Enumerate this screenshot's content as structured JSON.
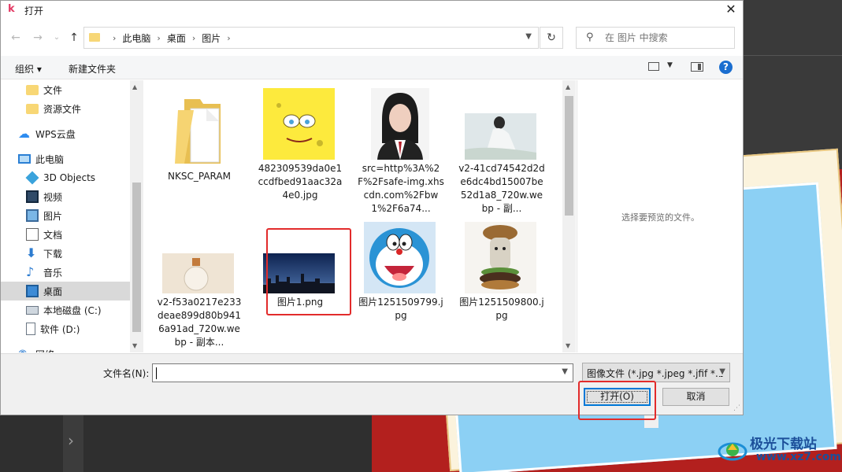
{
  "dialog": {
    "title": "打开",
    "app_icon_letter": "k",
    "close_glyph": "✕"
  },
  "nav": {
    "back_glyph": "←",
    "forward_glyph": "→",
    "recent_glyph": "⌄",
    "up_glyph": "↑",
    "breadcrumbs": [
      "此电脑",
      "桌面",
      "图片"
    ],
    "crumb_sep": "›",
    "refresh_glyph": "↻",
    "search_placeholder": "在 图片 中搜索"
  },
  "toolbar": {
    "organize": "组织 ▾",
    "new_folder": "新建文件夹",
    "help": "?"
  },
  "sidebar": {
    "items": [
      {
        "label": "文件",
        "icon": "folder-icon"
      },
      {
        "label": "资源文件",
        "icon": "folder-icon"
      },
      {
        "label": "WPS云盘",
        "icon": "cloud-icon"
      },
      {
        "label": "此电脑",
        "icon": "computer-icon"
      },
      {
        "label": "3D Objects",
        "icon": "3d-objects-icon"
      },
      {
        "label": "视频",
        "icon": "video-icon"
      },
      {
        "label": "图片",
        "icon": "pictures-icon"
      },
      {
        "label": "文档",
        "icon": "documents-icon"
      },
      {
        "label": "下载",
        "icon": "download-icon"
      },
      {
        "label": "音乐",
        "icon": "music-icon"
      },
      {
        "label": "桌面",
        "icon": "desktop-icon",
        "selected": true
      },
      {
        "label": "本地磁盘 (C:)",
        "icon": "drive-icon"
      },
      {
        "label": "软件 (D:)",
        "icon": "drive-icon"
      },
      {
        "label": "网络",
        "icon": "network-icon"
      }
    ]
  },
  "files": [
    {
      "label": "NKSC_PARAM",
      "kind": "folder"
    },
    {
      "label": "482309539da0e1ccdfbed91aac32a4e0.jpg",
      "kind": "image-spongebob"
    },
    {
      "label": "src=http%3A%2F%2Fsafe-img.xhscdn.com%2Fbw1%2F6a74...",
      "kind": "image-portrait"
    },
    {
      "label": "v2-41cd74542d2de6dc4bd15007be52d1a8_720w.webp - 副...",
      "kind": "image-woman"
    },
    {
      "label": "v2-f53a0217e233deae899d80b9416a91ad_720w.webp - 副本...",
      "kind": "image-bottle"
    },
    {
      "label": "图片1.png",
      "kind": "image-cityscape",
      "highlighted": true
    },
    {
      "label": "图片1251509799.jpg",
      "kind": "image-doraemon"
    },
    {
      "label": "图片1251509800.jpg",
      "kind": "image-cat-burger"
    }
  ],
  "preview": {
    "empty_text": "选择要预览的文件。"
  },
  "bottom": {
    "filename_label": "文件名(N):",
    "filename_value": "",
    "filter_value": "图像文件 (*.jpg *.jpeg *.jfif *.b",
    "open_button": "打开(O)",
    "cancel_button": "取消"
  },
  "watermark": {
    "text": "极光下载站",
    "url": "www.xz7.com"
  },
  "colors": {
    "accent": "#0078d7",
    "highlight_red": "#e22b2b",
    "selected_bg": "#d9d9d9"
  }
}
